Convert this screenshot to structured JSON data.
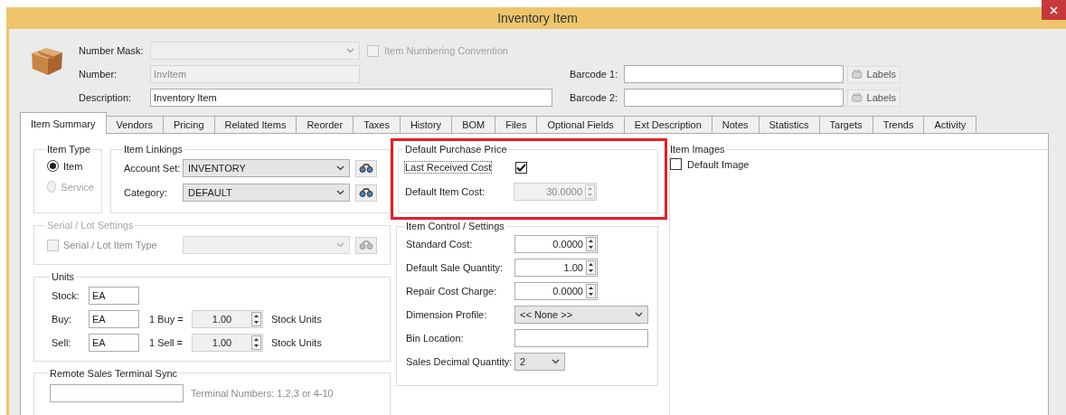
{
  "window": {
    "title": "Inventory Item"
  },
  "header": {
    "number_mask": {
      "label": "Number Mask:",
      "disabled": true
    },
    "numbering_convention": {
      "label": "Item Numbering Convention",
      "checked": false,
      "disabled": true
    },
    "number": {
      "label": "Number:",
      "value": "InvItem",
      "disabled": true
    },
    "description": {
      "label": "Description:",
      "value": "Inventory Item"
    },
    "barcodes": [
      {
        "label": "Barcode 1:",
        "button": "Labels"
      },
      {
        "label": "Barcode 2:",
        "button": "Labels"
      }
    ]
  },
  "tabs": [
    {
      "label": "Item Summary",
      "selected": true
    },
    {
      "label": "Vendors",
      "selected": false
    },
    {
      "label": "Pricing",
      "selected": false
    },
    {
      "label": "Related Items",
      "selected": false
    },
    {
      "label": "Reorder",
      "selected": false
    },
    {
      "label": "Taxes",
      "selected": false
    },
    {
      "label": "History",
      "selected": false
    },
    {
      "label": "BOM",
      "selected": false
    },
    {
      "label": "Files",
      "selected": false
    },
    {
      "label": "Optional Fields",
      "selected": false
    },
    {
      "label": "Ext Description",
      "selected": false
    },
    {
      "label": "Notes",
      "selected": false
    },
    {
      "label": "Statistics",
      "selected": false
    },
    {
      "label": "Targets",
      "selected": false
    },
    {
      "label": "Trends",
      "selected": false
    },
    {
      "label": "Activity",
      "selected": false
    }
  ],
  "item_type": {
    "title": "Item Type",
    "options": [
      {
        "label": "Item",
        "selected": true,
        "disabled": false
      },
      {
        "label": "Service",
        "selected": false,
        "disabled": true
      }
    ]
  },
  "item_linkings": {
    "title": "Item Linkings",
    "fields": [
      {
        "label": "Account Set:",
        "value": "INVENTORY"
      },
      {
        "label": "Category:",
        "value": "DEFAULT"
      }
    ]
  },
  "serial_lot": {
    "title": "Serial / Lot Settings",
    "disabled": true,
    "checkbox": {
      "label": "Serial / Lot Item Type",
      "checked": false
    }
  },
  "units": {
    "title": "Units",
    "rows": [
      {
        "kind": "base",
        "label": "Stock:",
        "value": "EA"
      },
      {
        "kind": "ratio",
        "label": "Buy:",
        "value": "EA",
        "ratio_label": "1 Buy =",
        "ratio": "1.00",
        "suffix": "Stock Units"
      },
      {
        "kind": "ratio",
        "label": "Sell:",
        "value": "EA",
        "ratio_label": "1 Sell =",
        "ratio": "1.00",
        "suffix": "Stock Units"
      }
    ]
  },
  "remote_sync": {
    "title": "Remote Sales Terminal Sync",
    "hint": "Terminal Numbers: 1,2,3 or 4-10"
  },
  "default_purchase_price": {
    "title": "Default Purchase Price",
    "highlighted": true,
    "last_received": {
      "label": "Last Received Cost",
      "checked": true
    },
    "default_cost": {
      "label": "Default Item Cost:",
      "value": "30.0000",
      "disabled": true
    }
  },
  "item_control": {
    "title": "Item Control / Settings",
    "fields": [
      {
        "kind": "spinner",
        "label": "Standard Cost:",
        "value": "0.0000"
      },
      {
        "kind": "spinner",
        "label": "Default Sale Quantity:",
        "value": "1.00"
      },
      {
        "kind": "spinner",
        "label": "Repair Cost Charge:",
        "value": "0.0000"
      },
      {
        "kind": "dropdown",
        "label": "Dimension Profile:",
        "value": "<< None >>"
      },
      {
        "kind": "text",
        "label": "Bin Location:"
      },
      {
        "kind": "short-dropdown",
        "label": "Sales Decimal Quantity:",
        "value": "2"
      }
    ]
  },
  "item_images": {
    "title": "Item Images",
    "default_image": {
      "label": "Default Image",
      "checked": false
    }
  }
}
